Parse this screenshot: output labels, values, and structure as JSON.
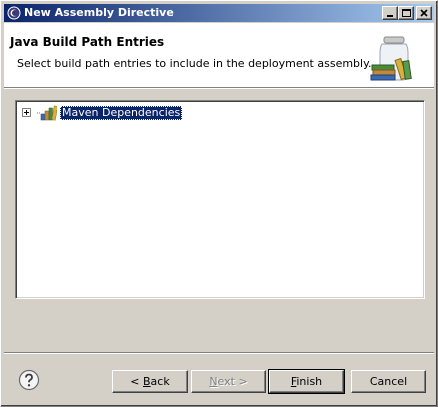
{
  "window": {
    "title": "New Assembly Directive",
    "controls": {
      "minimize": "minimize",
      "maximize": "maximize",
      "close": "close"
    }
  },
  "banner": {
    "title": "Java Build Path Entries",
    "description": "Select build path entries to include in the deployment assembly.",
    "image_icon": "library-jar-icon"
  },
  "tree": {
    "items": [
      {
        "label": "Maven Dependencies",
        "icon": "library-icon",
        "expanded": false,
        "selected": true
      }
    ]
  },
  "footer": {
    "help_icon": "help-icon",
    "back_prefix": "< ",
    "back_mnemonic": "B",
    "back_rest": "ack",
    "next_prefix": "",
    "next_mnemonic": "N",
    "next_rest": "ext >",
    "finish_mnemonic": "F",
    "finish_rest": "inish",
    "cancel_label": "Cancel"
  },
  "colors": {
    "title_gradient_start": "#0a246a",
    "title_gradient_end": "#a6caf0",
    "selection": "#0a246a",
    "dialog_bg": "#d4d0c8"
  }
}
